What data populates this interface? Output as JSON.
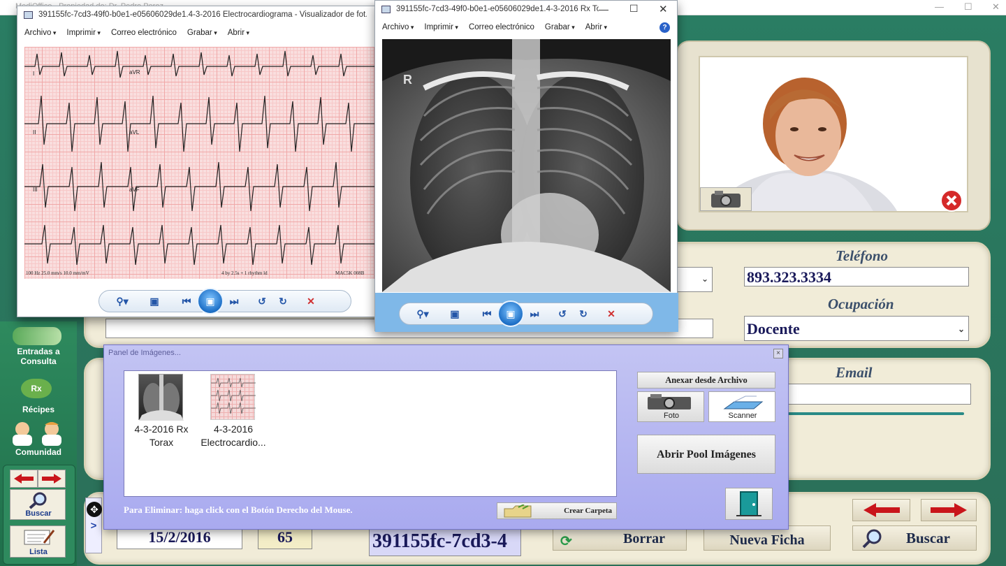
{
  "app": {
    "title": "MediOffice - Propiedad de: Dr. Pedro Perez",
    "window_controls": [
      "—",
      "☐",
      "✕"
    ]
  },
  "patient": {
    "telefono_label": "Teléfono",
    "telefono_value": "893.323.3334",
    "ocupacion_label": "Ocupación",
    "ocupacion_value": "Docente",
    "email_label": "Email",
    "email_value": ""
  },
  "bottom": {
    "date": "15/2/2016",
    "number": "65",
    "record_id": "391155fc-7cd3-4",
    "borrar": "Borrar",
    "nueva_ficha": "Nueva Ficha",
    "buscar": "Buscar"
  },
  "sidebar": {
    "entradas": "Entradas a Consulta",
    "recipes": "Récipes",
    "comunidad": "Comunidad",
    "buscar": "Buscar",
    "lista": "Lista",
    "rx_badge": "Rx"
  },
  "ecg_window": {
    "title": "391155fc-7cd3-49f0-b0e1-e05606029de1.4-3-2016 Electrocardiograma - Visualizador de fot...",
    "menu": [
      "Archivo",
      "Imprimir",
      "Correo electrónico",
      "Grabar",
      "Abrir"
    ],
    "lead_labels": [
      "aVR",
      "aVL",
      "aVF",
      "III",
      "II",
      "I"
    ],
    "footer_left": "100 Hz    25.0 mm/s    10.0 mm/mV",
    "footer_mid": "4 by 2.5s + 1 rhythm ld",
    "footer_right": "MAC5K 008B"
  },
  "xray_window": {
    "title": "391155fc-7cd3-49f0-b0e1-e05606029de1.4-3-2016 Rx Tora...",
    "menu": [
      "Archivo",
      "Imprimir",
      "Correo electrónico",
      "Grabar",
      "Abrir"
    ],
    "marker": "R",
    "controls": [
      "—",
      "☐",
      "✕"
    ]
  },
  "image_panel": {
    "title": "Panel de Imágenes...",
    "items": [
      {
        "label": "4-3-2016 Rx Torax"
      },
      {
        "label": "4-3-2016 Electrocardio..."
      }
    ],
    "anexar": "Anexar desde Archivo",
    "foto": "Foto",
    "scanner": "Scanner",
    "abrir_pool": "Abrir Pool Imágenes",
    "hint": "Para Eliminar: haga click con el Botón Derecho del Mouse.",
    "crear_carpeta": "Crear Carpeta"
  },
  "icons": [
    "camera-icon",
    "close-icon",
    "zoom-icon",
    "fit-icon",
    "prev-icon",
    "slideshow-icon",
    "next-icon",
    "rotate-left-icon",
    "rotate-right-icon",
    "delete-icon",
    "help-icon",
    "folder-icon",
    "exit-door-icon",
    "magnifier-icon",
    "arrow-left-icon",
    "arrow-right-icon",
    "scanner-icon",
    "move-icon"
  ]
}
